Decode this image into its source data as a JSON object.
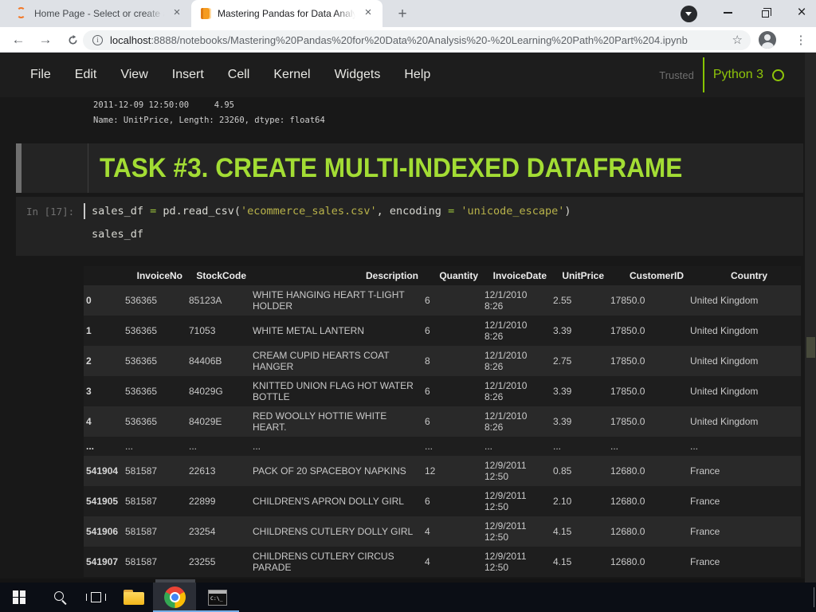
{
  "browser": {
    "tabs": [
      {
        "title": "Home Page - Select or create a n",
        "favicon": "jupyter-logo-icon",
        "active": false
      },
      {
        "title": "Mastering Pandas for Data Analy",
        "favicon": "notebook-book-icon",
        "active": true
      }
    ],
    "new_tab_glyph": "+",
    "close_glyph": "×",
    "window_close_glyph": "×",
    "nav": {
      "back_glyph": "←",
      "forward_glyph": "→",
      "star_glyph": "☆",
      "dots_glyph": "⋮",
      "info_glyph": "i"
    },
    "url": {
      "host": "localhost",
      "rest": ":8888/notebooks/Mastering%20Pandas%20for%20Data%20Analysis%20-%20Learning%20Path%20Part%204.ipynb"
    }
  },
  "jupyter": {
    "menu": [
      "File",
      "Edit",
      "View",
      "Insert",
      "Cell",
      "Kernel",
      "Widgets",
      "Help"
    ],
    "trusted_label": "Trusted",
    "kernel_name": "Python 3",
    "prev_output_line1": "2011-12-09 12:50:00     4.95",
    "prev_output_line2": "Name: UnitPrice, Length: 23260, dtype: float64",
    "heading": "TASK #3. CREATE MULTI-INDEXED DATAFRAME",
    "code_cell": {
      "prompt": "In [17]:",
      "line1": {
        "t1": "sales_df ",
        "op1": "=",
        "t2": " pd.read_csv(",
        "s1": "'ecommerce_sales.csv'",
        "t3": ", encoding ",
        "op2": "=",
        "t4": " ",
        "s2": "'unicode_escape'",
        "t5": ")"
      },
      "line2": "sales_df"
    },
    "colors": {
      "heading_green": "#a3dd34",
      "kernel_green": "#8fc50a",
      "code_string_yellow": "#b8b24a",
      "code_operator_green": "#9fc93c"
    }
  },
  "dataframe": {
    "columns": [
      "",
      "InvoiceNo",
      "StockCode",
      "Description",
      "Quantity",
      "InvoiceDate",
      "UnitPrice",
      "CustomerID",
      "Country"
    ],
    "rows": [
      [
        "0",
        "536365",
        "85123A",
        "WHITE HANGING HEART T-LIGHT HOLDER",
        "6",
        "12/1/2010 8:26",
        "2.55",
        "17850.0",
        "United Kingdom"
      ],
      [
        "1",
        "536365",
        "71053",
        "WHITE METAL LANTERN",
        "6",
        "12/1/2010 8:26",
        "3.39",
        "17850.0",
        "United Kingdom"
      ],
      [
        "2",
        "536365",
        "84406B",
        "CREAM CUPID HEARTS COAT HANGER",
        "8",
        "12/1/2010 8:26",
        "2.75",
        "17850.0",
        "United Kingdom"
      ],
      [
        "3",
        "536365",
        "84029G",
        "KNITTED UNION FLAG HOT WATER BOTTLE",
        "6",
        "12/1/2010 8:26",
        "3.39",
        "17850.0",
        "United Kingdom"
      ],
      [
        "4",
        "536365",
        "84029E",
        "RED WOOLLY HOTTIE WHITE HEART.",
        "6",
        "12/1/2010 8:26",
        "3.39",
        "17850.0",
        "United Kingdom"
      ],
      [
        "...",
        "...",
        "...",
        "...",
        "...",
        "...",
        "...",
        "...",
        "..."
      ],
      [
        "541904",
        "581587",
        "22613",
        "PACK OF 20 SPACEBOY NAPKINS",
        "12",
        "12/9/2011 12:50",
        "0.85",
        "12680.0",
        "France"
      ],
      [
        "541905",
        "581587",
        "22899",
        "CHILDREN'S APRON DOLLY GIRL",
        "6",
        "12/9/2011 12:50",
        "2.10",
        "12680.0",
        "France"
      ],
      [
        "541906",
        "581587",
        "23254",
        "CHILDRENS CUTLERY DOLLY GIRL",
        "4",
        "12/9/2011 12:50",
        "4.15",
        "12680.0",
        "France"
      ],
      [
        "541907",
        "581587",
        "23255",
        "CHILDRENS CUTLERY CIRCUS PARADE",
        "4",
        "12/9/2011 12:50",
        "4.15",
        "12680.0",
        "France"
      ]
    ]
  },
  "taskbar": {
    "terminal_text": "C:\\_",
    "items": [
      "start",
      "search",
      "task-view",
      "file-explorer",
      "chrome",
      "terminal"
    ]
  }
}
